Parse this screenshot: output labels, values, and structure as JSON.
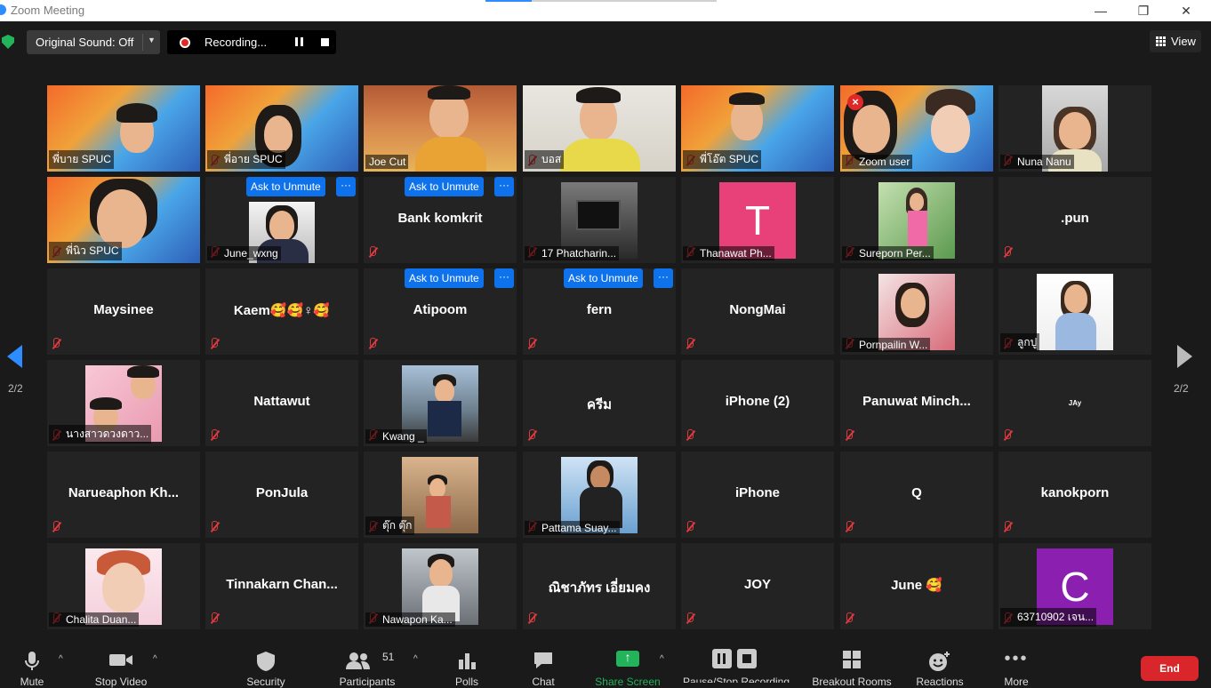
{
  "window": {
    "title": "Zoom Meeting",
    "minimize": "—",
    "restore": "❐",
    "close": "✕"
  },
  "topbar": {
    "original_sound": "Original Sound: Off",
    "recording": "Recording...",
    "view": "View"
  },
  "pager": {
    "left": "2/2",
    "right": "2/2"
  },
  "unmute_label": "Ask to Unmute",
  "more_label": "···",
  "tiles": [
    {
      "label": "พี่บาย SPUC"
    },
    {
      "label": "พี่อาย SPUC"
    },
    {
      "label": "Joe Cut"
    },
    {
      "label": "บอส"
    },
    {
      "label": "พี่โอ๊ต SPUC"
    },
    {
      "label": "Zoom user"
    },
    {
      "label": "Nuna Nanu"
    },
    {
      "label": "พี่นิว SPUC"
    },
    {
      "label": "June_wxng"
    },
    {
      "name": "Bank komkrit"
    },
    {
      "label": "17 Phatcharin..."
    },
    {
      "avatar": "T",
      "label": "Thanawat Ph..."
    },
    {
      "label": "Sureporn Per..."
    },
    {
      "name": ".pun"
    },
    {
      "name": "Maysinee"
    },
    {
      "name": "Kaem🥰🥰♀🥰"
    },
    {
      "name": "Atipoom"
    },
    {
      "name": "fern"
    },
    {
      "name": "NongMai"
    },
    {
      "label": "Pornpailin W..."
    },
    {
      "label": "ลูกปู"
    },
    {
      "label": "นางสาวดวงดาว..."
    },
    {
      "name": "Nattawut"
    },
    {
      "label": "Kwang _"
    },
    {
      "name": "ครีม"
    },
    {
      "name": "iPhone (2)"
    },
    {
      "name": "Panuwat  Minch..."
    },
    {
      "name": "JAy"
    },
    {
      "name": "Narueaphon  Kh..."
    },
    {
      "name": "PonJula"
    },
    {
      "label": "ตุ๊ก ตุ๊ก"
    },
    {
      "label": "Pattama Suay..."
    },
    {
      "name": "iPhone"
    },
    {
      "name": "Q"
    },
    {
      "name": "kanokporn"
    },
    {
      "label": "Chalita Duan..."
    },
    {
      "name": "Tinnakarn  Chan..."
    },
    {
      "label": "Nawapon Ka..."
    },
    {
      "name": "ณิชาภัทร เอี่ยมคง"
    },
    {
      "name": "JOY"
    },
    {
      "name": "June 🥰"
    },
    {
      "avatar": "C",
      "label": "63710902 เจน..."
    }
  ],
  "colors": {
    "avatar_T": "#e8417a",
    "avatar_C": "#8a1fb0",
    "accent": "#2d8cff",
    "end": "#d9262a"
  },
  "toolbar": {
    "mute": "Mute",
    "stop_video": "Stop Video",
    "security": "Security",
    "participants": "Participants",
    "participants_count": "51",
    "polls": "Polls",
    "chat": "Chat",
    "share_screen": "Share Screen",
    "pause_recording": "Pause/Stop Recording",
    "breakout": "Breakout Rooms",
    "reactions": "Reactions",
    "more": "More",
    "end": "End"
  }
}
